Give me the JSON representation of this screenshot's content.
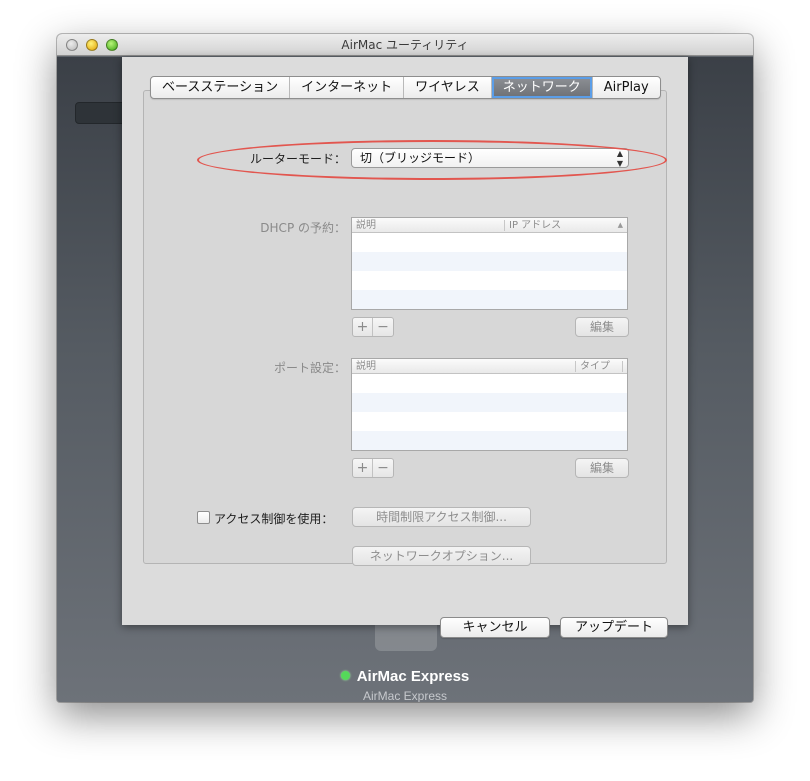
{
  "window": {
    "title": "AirMac ユーティリティ"
  },
  "tabs": [
    {
      "label": "ベースステーション",
      "selected": false
    },
    {
      "label": "インターネット",
      "selected": false
    },
    {
      "label": "ワイヤレス",
      "selected": false
    },
    {
      "label": "ネットワーク",
      "selected": true
    },
    {
      "label": "AirPlay",
      "selected": false
    }
  ],
  "router_mode": {
    "label": "ルーターモード：",
    "value": "切（ブリッジモード）"
  },
  "dhcp": {
    "label": "DHCP の予約：",
    "columns": [
      "説明",
      "IP アドレス"
    ],
    "add": "+",
    "remove": "−",
    "edit_label": "編集"
  },
  "ports": {
    "label": "ポート設定：",
    "columns": [
      "説明",
      "タイプ"
    ],
    "add": "+",
    "remove": "−",
    "edit_label": "編集"
  },
  "access_control": {
    "label": "アクセス制御を使用：",
    "checked": false,
    "timed_access_button": "時間制限アクセス制御..."
  },
  "network_options_button": "ネットワークオプション...",
  "footer": {
    "cancel": "キャンセル",
    "update": "アップデート"
  },
  "device": {
    "name": "AirMac Express",
    "model": "AirMac Express",
    "status_color": "#55d85a"
  },
  "colors": {
    "highlight_ellipse": "#e2564f",
    "selected_tab": "#7a7d82",
    "focus_ring": "#5b9ee8"
  }
}
